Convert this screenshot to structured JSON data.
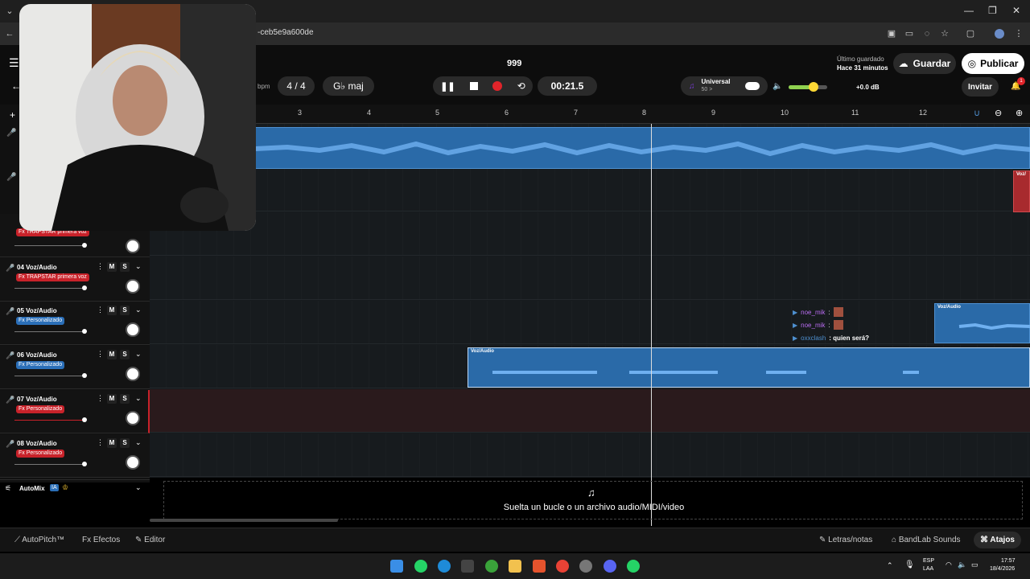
{
  "browser": {
    "url": "-ceb5e9a600de"
  },
  "header": {
    "project_title": "999",
    "last_saved_label": "Último guardado",
    "last_saved_value": "Hace 31 minutos",
    "save_label": "Guardar",
    "publish_label": "Publicar",
    "invite_label": "Invitar",
    "notification_count": "1",
    "bpm_label": "bpm",
    "time_signature": "4 / 4",
    "key": "G♭ maj",
    "timer": "00:21.5",
    "preset_name": "Universal",
    "preset_value": "50 >",
    "volume_db": "+0.0 dB",
    "volume_level": 0.65
  },
  "ruler": {
    "ticks": [
      "3",
      "4",
      "5",
      "6",
      "7",
      "8",
      "9",
      "10",
      "11",
      "12"
    ]
  },
  "tracks": [
    {
      "name": "04 Voz/Audio",
      "fx": "Fx TRAPSTAR primera voz",
      "fx_color": "red",
      "mute": "M",
      "solo": "S"
    },
    {
      "name": "05 Voz/Audio",
      "fx": "Fx Personalizado",
      "fx_color": "blue",
      "mute": "M",
      "solo": "S"
    },
    {
      "name": "06 Voz/Audio",
      "fx": "Fx Personalizado",
      "fx_color": "blue",
      "mute": "M",
      "solo": "S"
    },
    {
      "name": "07 Voz/Audio",
      "fx": "Fx Personalizado",
      "fx_color": "red",
      "mute": "M",
      "solo": "S"
    },
    {
      "name": "08 Voz/Audio",
      "fx": "Fx Personalizado",
      "fx_color": "red",
      "mute": "M",
      "solo": "S"
    }
  ],
  "partial_track_fx": "Fx TRAPSTAR primera voz",
  "automix": {
    "label": "AutoMix",
    "badge": "IA"
  },
  "clips": {
    "clip_label": "Voz/Audio",
    "top_clip_label": "Voz/"
  },
  "chat": [
    {
      "user": "noe_mik",
      "text": ":"
    },
    {
      "user": "noe_mik",
      "text": ":"
    },
    {
      "user": "oxxclash",
      "text": ": quien será?"
    }
  ],
  "drop_zone": {
    "text": "Suelta un bucle o un archivo audio/MIDI/video"
  },
  "bottom_bar": {
    "autopitch": "AutoPitch™",
    "effects": "Efectos",
    "editor": "Editor",
    "lyrics": "Letras/notas",
    "sounds": "BandLab Sounds",
    "shortcuts": "Atajos"
  },
  "taskbar": {
    "lang": "ESP",
    "lang2": "LAA",
    "time": "17:57",
    "date": "18/4/2026"
  },
  "colors": {
    "accent_blue": "#2a6aa8",
    "record_red": "#e0242a",
    "fx_red": "#c8222a",
    "fx_blue": "#2b6fb8"
  }
}
